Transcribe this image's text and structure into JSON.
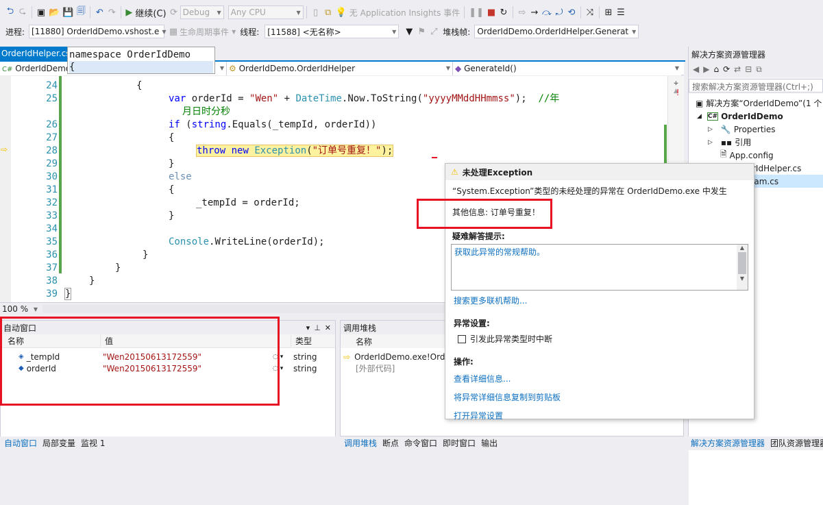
{
  "toolbar1": {
    "continue_label": "继续(C)",
    "config": "Debug",
    "platform": "Any CPU",
    "insights": "无 Application Insights 事件"
  },
  "toolbar2": {
    "process_label": "进程:",
    "process_value": "[11880] OrderIdDemo.vshost.e",
    "lifecycle": "生命周期事件",
    "thread_label": "线程:",
    "thread_value": "[11588] <无名称>",
    "stackframe_label": "堆栈帧:",
    "stackframe_value": "OrderIdDemo.OrderIdHelper.Generat"
  },
  "editor": {
    "tab": "OrderIdHelper.cs",
    "tooltip_line1": "namespace OrderIdDemo",
    "tooltip_line2": "{",
    "nav_project": "OrderIdDemo",
    "nav_class": "OrderIdDemo.OrderIdHelper",
    "nav_member": "GenerateId()",
    "zoom": "100 %",
    "lines": [
      {
        "n": "24",
        "code": "            {"
      },
      {
        "n": "25",
        "code": "var orderId = \"Wen\" + DateTime.Now.ToString(\"yyyyMMddHHmmss\");  //年"
      },
      {
        "n": "",
        "code": "月日时分秒"
      },
      {
        "n": "26",
        "code": "if (string.Equals(_tempId, orderId))"
      },
      {
        "n": "27",
        "code": "{"
      },
      {
        "n": "28",
        "code": "throw new Exception(\"订单号重复！\");"
      },
      {
        "n": "29",
        "code": "}"
      },
      {
        "n": "30",
        "code": "else"
      },
      {
        "n": "31",
        "code": "{"
      },
      {
        "n": "32",
        "code": "_tempId = orderId;"
      },
      {
        "n": "33",
        "code": "}"
      },
      {
        "n": "34",
        "code": ""
      },
      {
        "n": "35",
        "code": "Console.WriteLine(orderId);"
      },
      {
        "n": "36",
        "code": "}"
      },
      {
        "n": "37",
        "code": "}"
      },
      {
        "n": "38",
        "code": "}"
      },
      {
        "n": "39",
        "code": "}"
      }
    ]
  },
  "exception": {
    "title": "未处理Exception",
    "message": "“System.Exception”类型的未经处理的异常在 OrderIdDemo.exe 中发生",
    "extra": "其他信息: 订单号重复！",
    "tips_header": "疑难解答提示:",
    "tips_link": "获取此异常的常规帮助。",
    "search_link": "搜索更多联机帮助...",
    "settings_header": "异常设置:",
    "break_checkbox": "引发此异常类型时中断",
    "actions_header": "操作:",
    "action1": "查看详细信息...",
    "action2": "将异常详细信息复制到剪贴板",
    "action3": "打开异常设置"
  },
  "autos": {
    "title": "自动窗口",
    "col_name": "名称",
    "col_value": "值",
    "col_type": "类型",
    "rows": [
      {
        "name": "_tempId",
        "value": "\"Wen20150613172559\"",
        "type": "string"
      },
      {
        "name": "orderId",
        "value": "\"Wen20150613172559\"",
        "type": "string"
      }
    ],
    "tabs": [
      "自动窗口",
      "局部变量",
      "监视 1"
    ]
  },
  "callstack": {
    "title": "调用堆栈",
    "col_name": "名称",
    "rows": [
      "OrderIdDemo.exe!OrderI",
      "[外部代码]"
    ],
    "tabs": [
      "调用堆栈",
      "断点",
      "命令窗口",
      "即时窗口",
      "输出"
    ]
  },
  "solution": {
    "title": "解决方案资源管理器",
    "search": "搜索解决方案资源管理器(Ctrl+;)",
    "solution_item": "解决方案“OrderIdDemo”(1 个",
    "project": "OrderIdDemo",
    "properties": "Properties",
    "references": "引用",
    "appconfig": "App.config",
    "helper": "OrderIdHelper.cs",
    "program": "Program.cs",
    "tabs": [
      "解决方案资源管理器",
      "团队资源管理器"
    ]
  },
  "colors": {
    "accent": "#007acc",
    "highlight_box": "#e81123",
    "selection": "#fff29e"
  }
}
